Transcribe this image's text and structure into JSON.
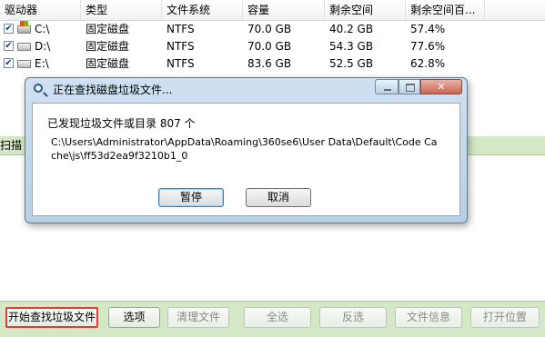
{
  "table": {
    "columns": [
      "驱动器",
      "类型",
      "文件系统",
      "容量",
      "剩余空间",
      "剩余空间百..."
    ],
    "rows": [
      {
        "drive": "C:\\",
        "type": "固定磁盘",
        "fs": "NTFS",
        "capacity": "70.0 GB",
        "free": "40.2 GB",
        "free_pct": "57.4%",
        "checked": "✔"
      },
      {
        "drive": "D:\\",
        "type": "固定磁盘",
        "fs": "NTFS",
        "capacity": "70.0 GB",
        "free": "54.3 GB",
        "free_pct": "77.6%",
        "checked": "✔"
      },
      {
        "drive": "E:\\",
        "type": "固定磁盘",
        "fs": "NTFS",
        "capacity": "83.6 GB",
        "free": "52.5 GB",
        "free_pct": "62.8%",
        "checked": "✔"
      }
    ]
  },
  "scan_label": "扫描",
  "buttons": {
    "start": "开始查找垃圾文件",
    "options": "选项",
    "clean": "清理文件",
    "select_all": "全选",
    "invert": "反选",
    "file_info": "文件信息",
    "open_location": "打开位置"
  },
  "dialog": {
    "title": "正在查找磁盘垃圾文件...",
    "found_text": "已发现垃圾文件或目录 807 个",
    "current_path": "C:\\Users\\Administrator\\AppData\\Roaming\\360se6\\User Data\\Default\\Code Cache\\js\\ff53d2ea9f3210b1_0",
    "pause_label": "暂停",
    "cancel_label": "取消",
    "close_glyph": "✕"
  },
  "colors": {
    "highlight_border": "#e03b3b",
    "window_background": "#d4e8c6"
  }
}
